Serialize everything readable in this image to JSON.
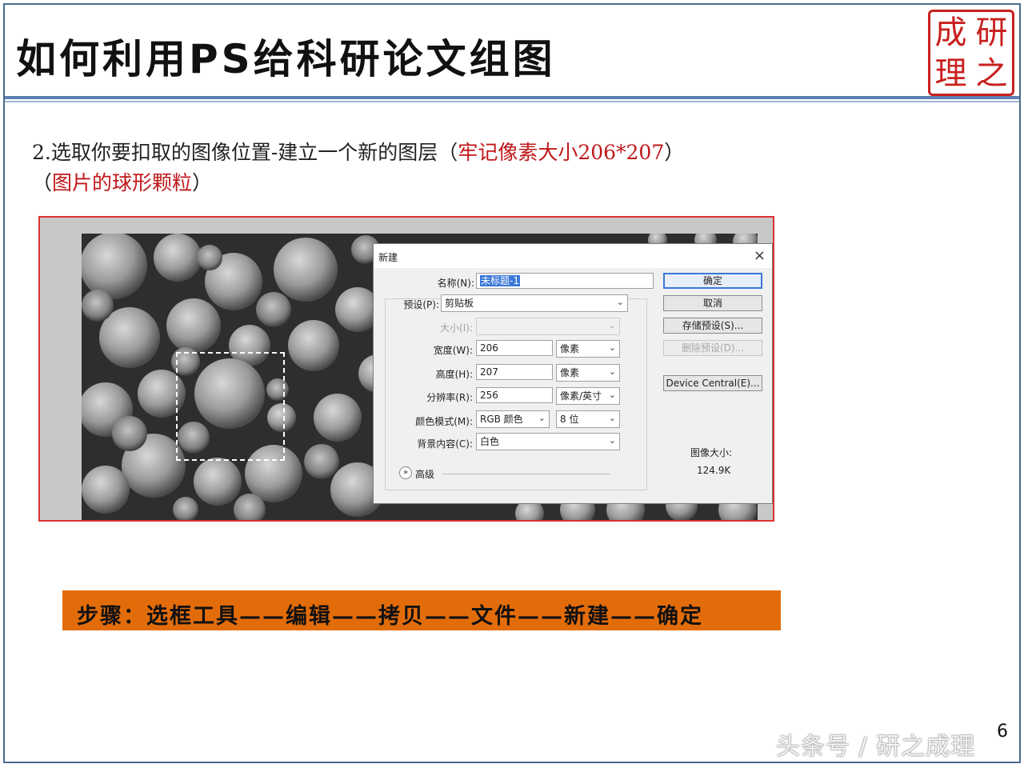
{
  "slide": {
    "title": "如何利用PS给科研论文组图",
    "seal_chars": [
      "成",
      "研",
      "理",
      "之"
    ],
    "step_prefix": "2.选取你要扣取的图像位置-建立一个新的图层（",
    "step_red1": "牢记像素大小206*207",
    "step_suffix1": "）",
    "step_line2_open": "（",
    "step_red2": "图片的球形颗粒",
    "step_line2_close": "）",
    "steps_banner": "步骤：选框工具——编辑——拷贝——文件——新建——确定",
    "page_number": "6",
    "watermark": "头条号 / 研之成理"
  },
  "dialog": {
    "title": "新建",
    "close_glyph": "×",
    "name_label": "名称(N):",
    "name_value": "未标题-1",
    "preset_label": "预设(P):",
    "preset_value": "剪贴板",
    "size_label": "大小(I):",
    "width_label": "宽度(W):",
    "width_value": "206",
    "width_unit": "像素",
    "height_label": "高度(H):",
    "height_value": "207",
    "height_unit": "像素",
    "resolution_label": "分辨率(R):",
    "resolution_value": "256",
    "resolution_unit": "像素/英寸",
    "color_mode_label": "颜色模式(M):",
    "color_mode_value": "RGB 颜色",
    "bit_depth_value": "8 位",
    "background_label": "背景内容(C):",
    "background_value": "白色",
    "advanced_label": "高级",
    "image_size_label": "图像大小:",
    "image_size_value": "124.9K",
    "buttons": {
      "ok": "确定",
      "cancel": "取消",
      "save_preset": "存储预设(S)...",
      "delete_preset": "删除预设(D)...",
      "device_central": "Device Central(E)..."
    }
  },
  "colors": {
    "accent_red": "#c0181a",
    "banner_orange": "#e36c0a",
    "title_rule": "#5b7fb0"
  }
}
